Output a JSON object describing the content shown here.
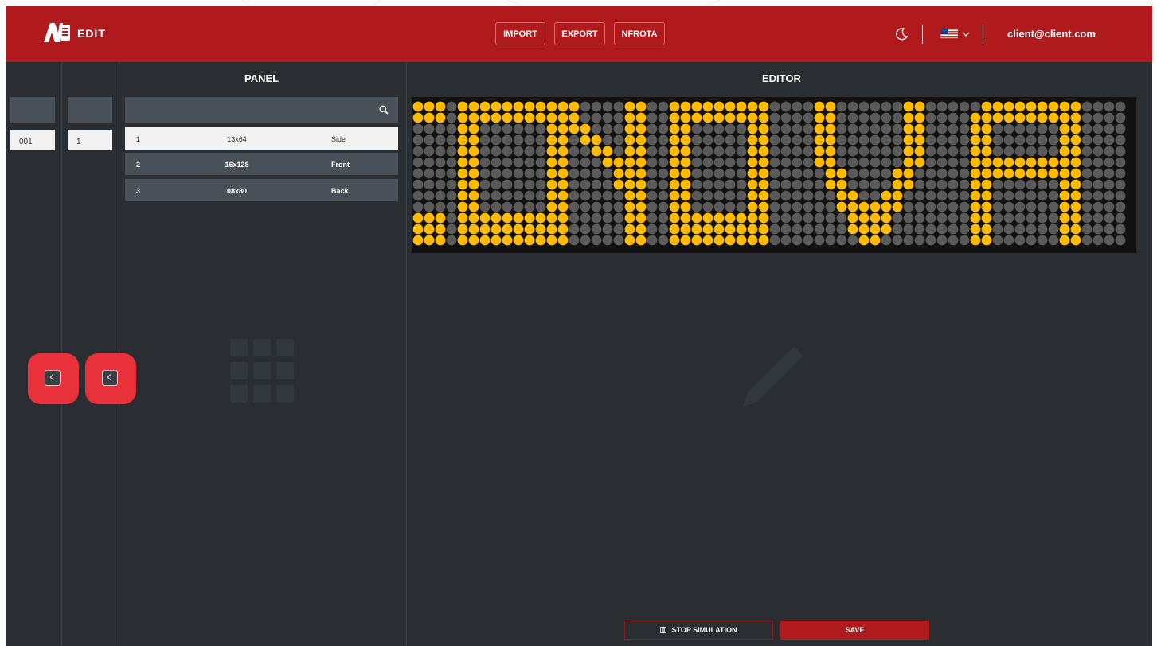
{
  "header": {
    "logo_text": "EDIT",
    "buttons": [
      "IMPORT",
      "EXPORT",
      "NFROTA"
    ],
    "user_email": "client@client.com"
  },
  "panel": {
    "title": "PANEL",
    "code_value": "001",
    "number_value": "1",
    "search_placeholder": "",
    "rows": [
      {
        "index": "1",
        "size": "13x64",
        "position": "Side",
        "selected": true
      },
      {
        "index": "2",
        "size": "16x128",
        "position": "Front",
        "selected": false
      },
      {
        "index": "3",
        "size": "08x80",
        "position": "Back",
        "selected": false
      }
    ]
  },
  "editor": {
    "title": "EDITOR",
    "led": {
      "rows": 13,
      "cols": 64,
      "on_color": "#ffbb00",
      "off_color": "#5a5a5a",
      "text": "CNDVA"
    }
  },
  "footer": {
    "stop_label": "STOP SIMULATION",
    "save_label": "SAVE"
  },
  "colors": {
    "header_bg": "#b01a1c",
    "app_bg": "#2a2e32",
    "highlight": "#e8313a",
    "accent": "#ffbb00"
  },
  "icons": [
    "logo-icon",
    "moon-icon",
    "us-flag-icon",
    "chevron-down-icon",
    "search-icon",
    "chevron-left-icon",
    "grid-icon",
    "pencil-icon",
    "pause-icon"
  ]
}
